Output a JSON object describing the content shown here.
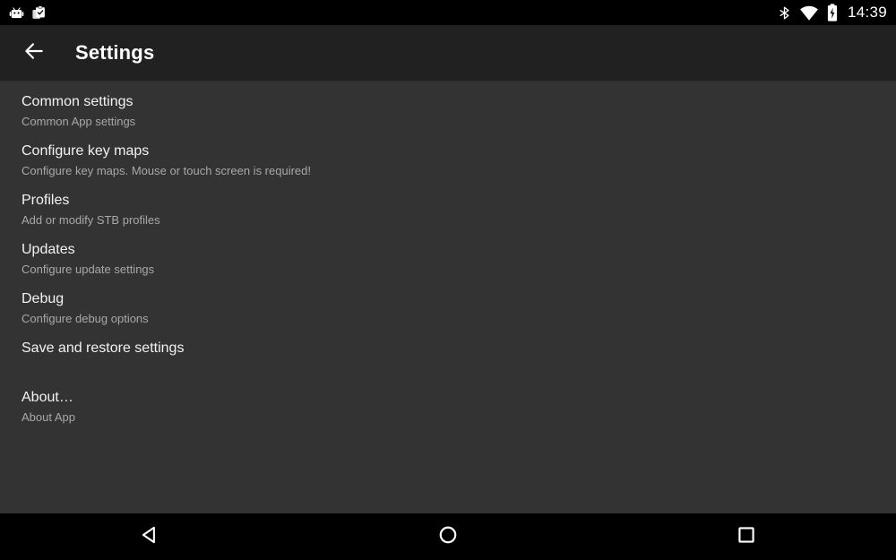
{
  "status_bar": {
    "left_icons": [
      {
        "name": "android-robot-notification-icon",
        "label": "app notification"
      },
      {
        "name": "clipboard-check-notification-icon",
        "label": "clipboard notification"
      }
    ],
    "right_icons": [
      {
        "name": "bluetooth-icon",
        "label": "Bluetooth"
      },
      {
        "name": "wifi-icon",
        "label": "Wi-Fi"
      },
      {
        "name": "battery-charging-icon",
        "label": "Battery charging"
      }
    ],
    "clock": "14:39",
    "background_color": "#000000",
    "icon_color": "#ffffff"
  },
  "toolbar": {
    "back_icon": "arrow-left-icon",
    "title": "Settings",
    "background_color": "#212121",
    "text_color": "#ffffff"
  },
  "content": {
    "background_color": "#333333",
    "title_color": "#f2f2f2",
    "summary_color": "#a8a8a8",
    "items": [
      {
        "title": "Common settings",
        "summary": "Common App settings"
      },
      {
        "title": "Configure key maps",
        "summary": "Configure key maps. Mouse or touch screen is required!"
      },
      {
        "title": "Profiles",
        "summary": "Add or modify STB profiles"
      },
      {
        "title": "Updates",
        "summary": "Configure update settings"
      },
      {
        "title": "Debug",
        "summary": "Configure debug options"
      },
      {
        "title": "Save and restore settings",
        "summary": ""
      },
      {
        "title": "About…",
        "summary": "About App"
      }
    ]
  },
  "nav_bar": {
    "background_color": "#000000",
    "icon_color": "#ffffff",
    "buttons": [
      {
        "name": "nav-back-button",
        "icon": "triangle-left-icon",
        "label": "Back"
      },
      {
        "name": "nav-home-button",
        "icon": "circle-icon",
        "label": "Home"
      },
      {
        "name": "nav-recents-button",
        "icon": "square-icon",
        "label": "Recents"
      }
    ]
  }
}
